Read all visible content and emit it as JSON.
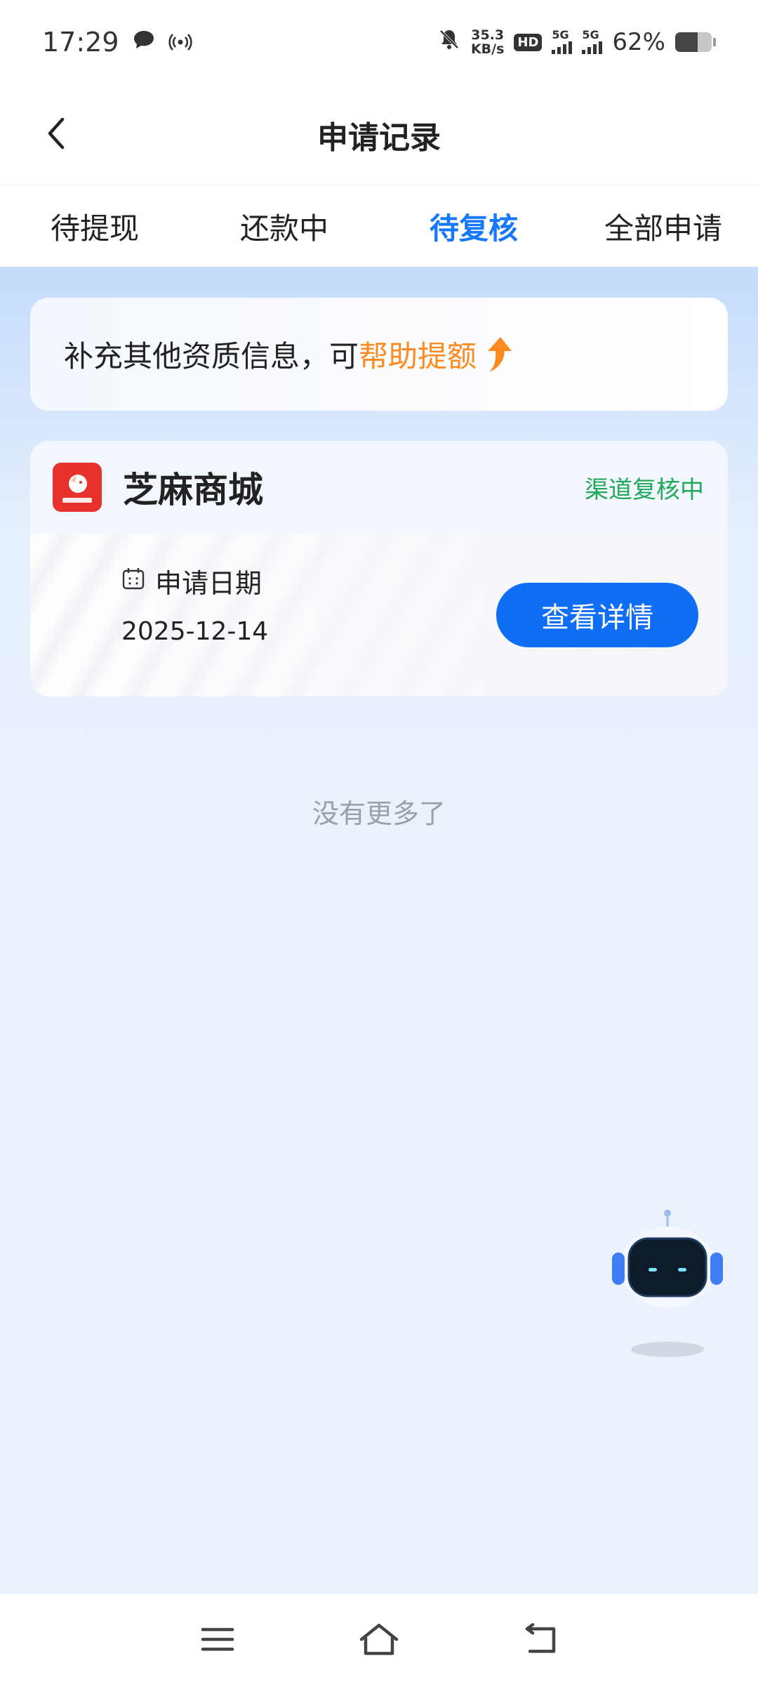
{
  "status_bar": {
    "time": "17:29",
    "net_speed_value": "35.3",
    "net_speed_unit": "KB/s",
    "hd_label": "HD",
    "sim1_label": "5G",
    "sim2_label": "5G",
    "battery_percent": "62%",
    "battery_level": 0.62
  },
  "header": {
    "title": "申请记录"
  },
  "tabs": [
    {
      "label": "待提现",
      "active": false
    },
    {
      "label": "还款中",
      "active": false
    },
    {
      "label": "待复核",
      "active": true
    },
    {
      "label": "全部申请",
      "active": false
    }
  ],
  "promo": {
    "text": "补充其他资质信息，可",
    "highlight": "帮助提额"
  },
  "application": {
    "app_name": "芝麻商城",
    "status": "渠道复核中",
    "date_label": "申请日期",
    "date_value": "2025-12-14",
    "detail_button": "查看详情"
  },
  "list_footer": "没有更多了",
  "colors": {
    "accent": "#1677ff",
    "button": "#0f6df6",
    "highlight": "#ff8a1f",
    "status_green": "#1fa85a",
    "app_icon": "#e8312a"
  },
  "icons": {
    "back": "chevron-left-icon",
    "calendar": "calendar-icon",
    "promo_arrow": "arrow-up-icon",
    "assistant": "robot-assistant-icon",
    "nav_menu": "menu-icon",
    "nav_home": "home-icon",
    "nav_back": "back-icon"
  }
}
